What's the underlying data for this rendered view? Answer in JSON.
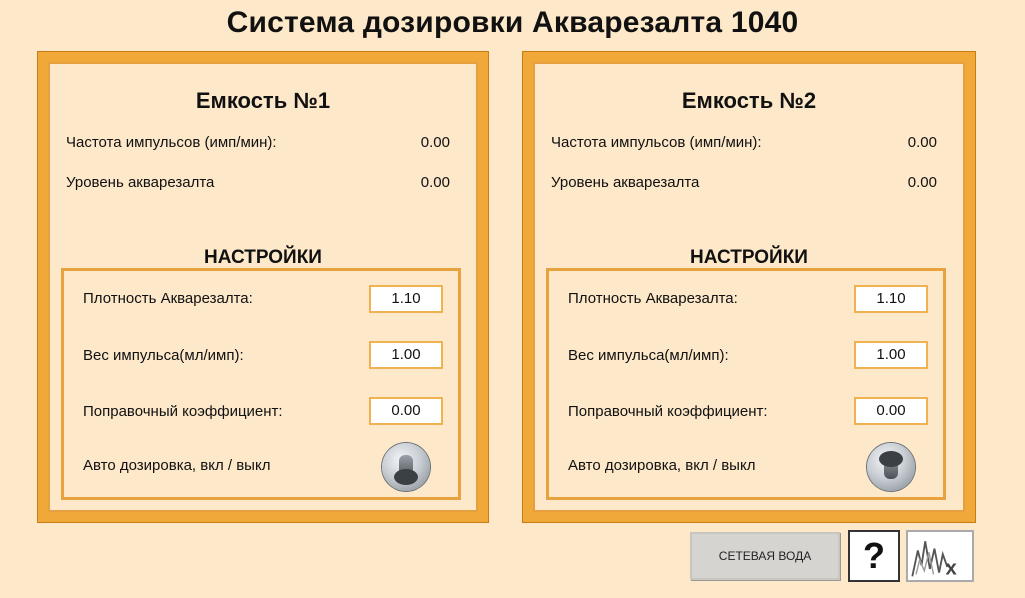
{
  "title": "Система дозировки Акварезалта 1040",
  "tanks": [
    {
      "name": "Емкость №1",
      "pulse_freq_label": "Частота импульсов (имп/мин):",
      "pulse_freq_value": "0.00",
      "level_label": "Уровень акварезалта",
      "level_value": "0.00",
      "settings_title": "НАСТРОЙКИ",
      "density_label": "Плотность Акварезалта:",
      "density_value": "1.10",
      "pulse_weight_label": "Вес импульса(мл/имп):",
      "pulse_weight_value": "1.00",
      "correction_label": "Поправочный коэффициент:",
      "correction_value": "0.00",
      "auto_label": "Авто дозировка, вкл / выкл",
      "auto_state": "off"
    },
    {
      "name": "Емкость №2",
      "pulse_freq_label": "Частота импульсов (имп/мин):",
      "pulse_freq_value": "0.00",
      "level_label": "Уровень акварезалта",
      "level_value": "0.00",
      "settings_title": "НАСТРОЙКИ",
      "density_label": "Плотность Акварезалта:",
      "density_value": "1.10",
      "pulse_weight_label": "Вес импульса(мл/имп):",
      "pulse_weight_value": "1.00",
      "correction_label": "Поправочный коэффициент:",
      "correction_value": "0.00",
      "auto_label": "Авто дозировка, вкл / выкл",
      "auto_state": "on"
    }
  ],
  "buttons": {
    "network_water": "СЕТЕВАЯ ВОДА",
    "help": "?",
    "trend_icon": "trend-chart-icon"
  },
  "colors": {
    "background": "#fde8c9",
    "frame": "#f0a838",
    "settings_border": "#e8a23e"
  }
}
